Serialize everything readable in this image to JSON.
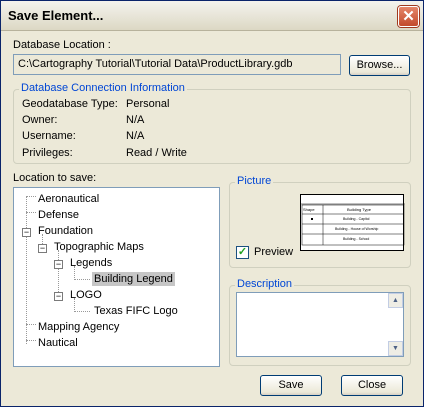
{
  "window": {
    "title": "Save Element...",
    "close_glyph": "✕"
  },
  "database": {
    "location_label": "Database Location :",
    "location_value": "C:\\Cartography Tutorial\\Tutorial Data\\ProductLibrary.gdb",
    "browse_label": "Browse..."
  },
  "connection": {
    "group_title": "Database Connection Information",
    "rows": [
      {
        "key": "Geodatabase Type:",
        "value": "Personal"
      },
      {
        "key": "Owner:",
        "value": "N/A"
      },
      {
        "key": "Username:",
        "value": "N/A"
      },
      {
        "key": "Privileges:",
        "value": "Read / Write"
      }
    ]
  },
  "location": {
    "label": "Location to save:",
    "tree": {
      "aeronautical": "Aeronautical",
      "defense": "Defense",
      "foundation": "Foundation",
      "topographic_maps": "Topographic Maps",
      "legends": "Legends",
      "building_legend": "Building Legend",
      "logo": "LOGO",
      "texas_logo": "Texas FIFC Logo",
      "mapping_agency": "Mapping Agency",
      "nautical": "Nautical"
    },
    "selected": "Building Legend"
  },
  "picture": {
    "group_title": "Picture",
    "preview_label": "Preview",
    "preview_checked": true,
    "table_header": [
      "Shape",
      "Building Type"
    ],
    "table_rows": [
      "Building - Capitol",
      "Building - House of Worship",
      "Building - School"
    ]
  },
  "description": {
    "group_title": "Description",
    "value": ""
  },
  "buttons": {
    "save": "Save",
    "close": "Close"
  }
}
